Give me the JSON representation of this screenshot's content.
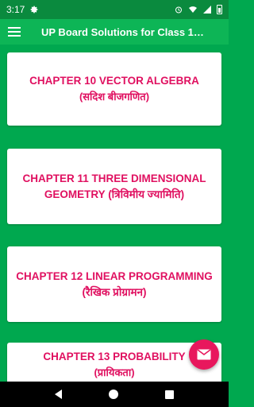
{
  "status_bar": {
    "time": "3:17",
    "icons": [
      "gear-icon",
      "alarm-icon",
      "wifi-icon",
      "signal-icon",
      "battery-icon"
    ]
  },
  "app_bar": {
    "title": "UP Board Solutions for Class 1…",
    "menu_icon": "hamburger-menu-icon"
  },
  "chapters": [
    {
      "title": "CHAPTER 10 VECTOR ALGEBRA",
      "subtitle": "(सदिश बीजगणित)"
    },
    {
      "title": "CHAPTER 11 THREE DIMENSIONAL GEOMETRY",
      "subtitle": "(त्रिविमीय ज्यामिति)"
    },
    {
      "title": "CHAPTER 12 LINEAR PROGRAMMING",
      "subtitle": "(रैखिक प्रोग्रामन)"
    },
    {
      "title": "CHAPTER 13 PROBABILITY",
      "subtitle": "(प्रायिकता)"
    }
  ],
  "fab": {
    "icon": "mail-icon"
  },
  "colors": {
    "status_bar": "#0a8a3e",
    "app_bar": "#0db556",
    "background": "#00a84f",
    "chapter_text": "#e01060",
    "fab": "#e8175d"
  }
}
